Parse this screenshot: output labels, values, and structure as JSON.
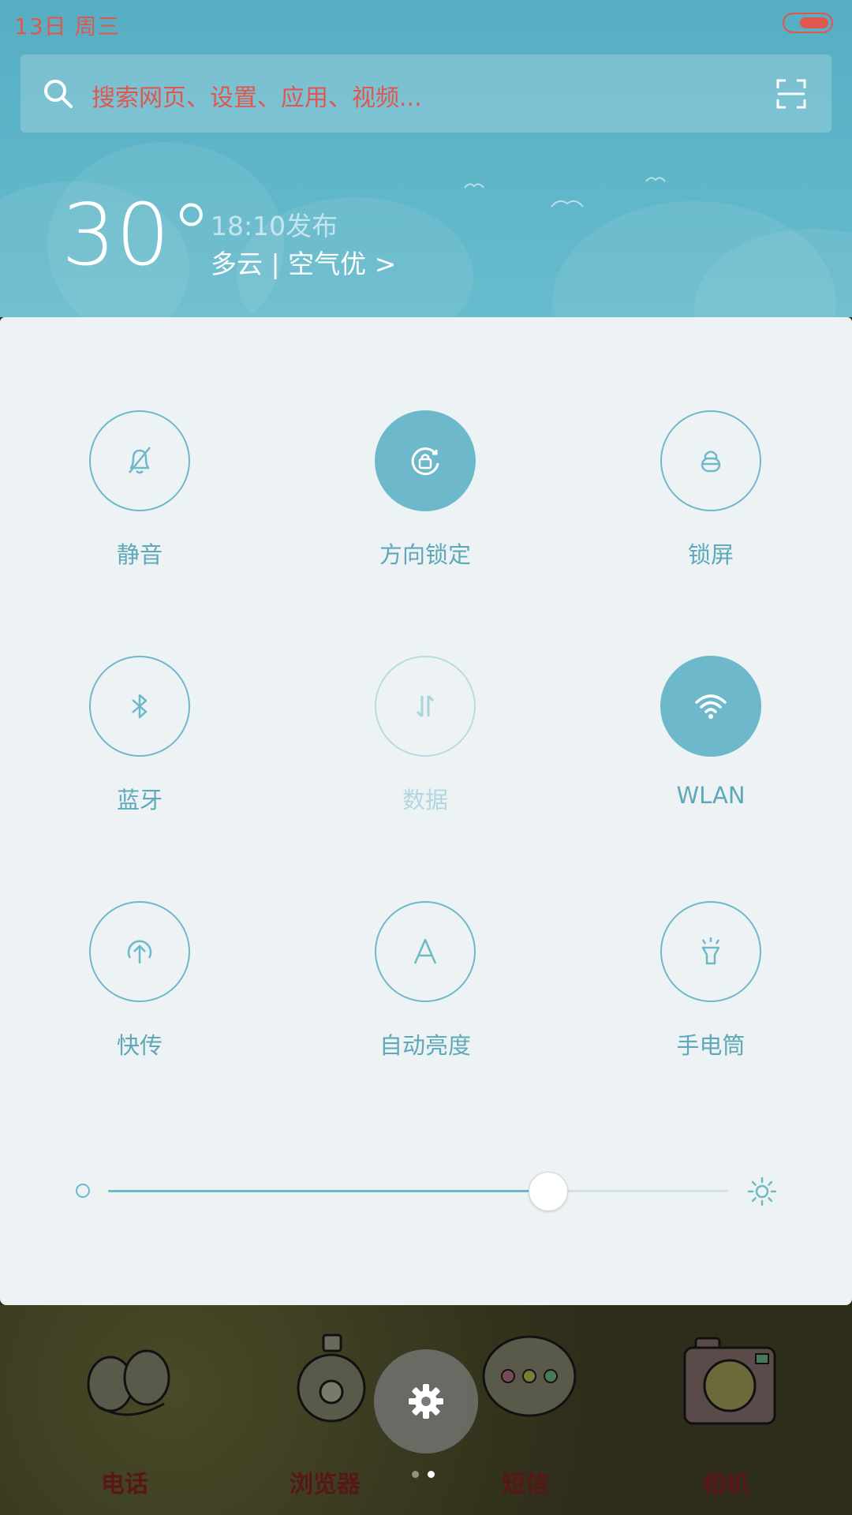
{
  "status_bar": {
    "date_text": "13日  周三"
  },
  "search": {
    "placeholder": "搜索网页、设置、应用、视频..."
  },
  "weather": {
    "temperature": "30°",
    "publish_time": "18:10发布",
    "description": "多云 | 空气优 >"
  },
  "quick_toggles": [
    {
      "label": "静音",
      "icon": "bell-off-icon",
      "state": "off"
    },
    {
      "label": "方向锁定",
      "icon": "rotation-lock-icon",
      "state": "on"
    },
    {
      "label": "锁屏",
      "icon": "lock-icon",
      "state": "off"
    },
    {
      "label": "蓝牙",
      "icon": "bluetooth-icon",
      "state": "off"
    },
    {
      "label": "数据",
      "icon": "mobile-data-icon",
      "state": "disabled"
    },
    {
      "label": "WLAN",
      "icon": "wifi-icon",
      "state": "on"
    },
    {
      "label": "快传",
      "icon": "quick-share-icon",
      "state": "off"
    },
    {
      "label": "自动亮度",
      "icon": "auto-brightness-icon",
      "state": "off"
    },
    {
      "label": "手电筒",
      "icon": "flashlight-icon",
      "state": "off"
    }
  ],
  "brightness": {
    "level": 0.71
  },
  "dock": {
    "apps": [
      {
        "label": "电话",
        "icon": "phone-app-icon"
      },
      {
        "label": "浏览器",
        "icon": "browser-app-icon"
      },
      {
        "label": "短信",
        "icon": "messages-app-icon"
      },
      {
        "label": "相机",
        "icon": "camera-app-icon"
      }
    ],
    "settings_icon": "gear-icon",
    "page_indicator": {
      "count": 2,
      "current": 1
    }
  },
  "colors": {
    "accent": "#6db9cb",
    "status_text": "#e0574f",
    "panel_bg": "#edf3f4",
    "header_bg": "#5ab1c5"
  }
}
